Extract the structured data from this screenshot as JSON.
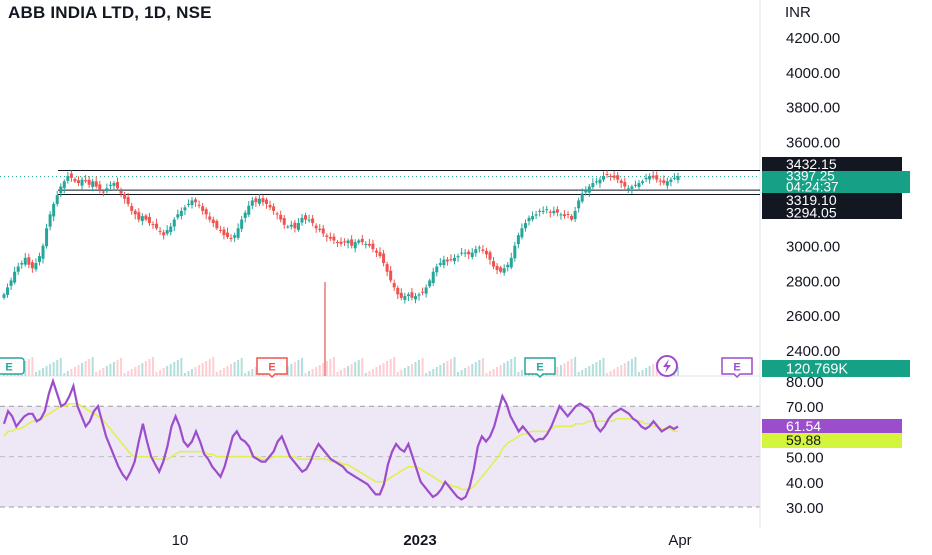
{
  "header": {
    "title": "ABB INDIA LTD, 1D, NSE"
  },
  "price_axis": {
    "currency": "INR",
    "ticks": [
      "4200.00",
      "4000.00",
      "3800.00",
      "3600.00",
      "3000.00",
      "2800.00",
      "2600.00",
      "2400.00"
    ],
    "tick_values": [
      4200,
      4000,
      3800,
      3600,
      3000,
      2800,
      2600,
      2400
    ]
  },
  "price_labels": {
    "resistance": "3432.15",
    "last": "3397.25",
    "countdown": "04:24:37",
    "support_upper": "3319.10",
    "support_lower": "3294.05",
    "volume": "120.769K"
  },
  "levels": {
    "resistance": 3432.15,
    "last": 3397.25,
    "support_upper": 3319.1,
    "support_lower": 3294.05
  },
  "rsi_axis": {
    "ticks": [
      "80.00",
      "70.00",
      "50.00",
      "40.00",
      "30.00"
    ],
    "tick_values": [
      80,
      70,
      50,
      40,
      30
    ],
    "rsi_label": "61.54",
    "ma_label": "59.88",
    "rsi_value": 61.54,
    "ma_value": 59.88,
    "band": [
      30,
      70
    ]
  },
  "time_axis": {
    "labels": [
      "10",
      "2023",
      "Apr"
    ]
  },
  "earnings_markers": {
    "label": "E"
  },
  "colors": {
    "up": "#26a69a",
    "down": "#ef5350",
    "rsi": "#9c4dcc",
    "rsi_ma": "#e1f04a",
    "band": "#ede7f6",
    "last_price": "#16a085",
    "rsi_badge": "#9c4dcc",
    "ma_badge": "#d4f53b"
  },
  "chart_data": {
    "type": "candlestick",
    "price_range": [
      2300,
      4300
    ],
    "rsi_range": [
      28,
      82
    ],
    "candles_close": [
      2720,
      2760,
      2800,
      2850,
      2880,
      2900,
      2930,
      2890,
      2870,
      2900,
      2940,
      3000,
      3100,
      3180,
      3240,
      3290,
      3340,
      3370,
      3400,
      3390,
      3370,
      3360,
      3380,
      3370,
      3350,
      3370,
      3340,
      3320,
      3310,
      3330,
      3350,
      3360,
      3330,
      3300,
      3270,
      3240,
      3200,
      3180,
      3150,
      3170,
      3150,
      3130,
      3120,
      3100,
      3080,
      3060,
      3090,
      3110,
      3150,
      3180,
      3200,
      3220,
      3240,
      3260,
      3250,
      3230,
      3200,
      3180,
      3150,
      3130,
      3100,
      3090,
      3060,
      3050,
      3040,
      3060,
      3100,
      3150,
      3190,
      3230,
      3260,
      3250,
      3270,
      3250,
      3240,
      3220,
      3200,
      3180,
      3150,
      3120,
      3110,
      3120,
      3100,
      3130,
      3160,
      3150,
      3150,
      3130,
      3100,
      3090,
      3070,
      3050,
      3040,
      3030,
      3020,
      3010,
      3020,
      3030,
      3000,
      3020,
      3030,
      3020,
      3010,
      3000,
      2980,
      2960,
      2940,
      2900,
      2850,
      2800,
      2760,
      2720,
      2700,
      2710,
      2720,
      2700,
      2710,
      2720,
      2730,
      2760,
      2800,
      2850,
      2880,
      2900,
      2920,
      2910,
      2920,
      2930,
      2940,
      2960,
      2960,
      2950,
      2960,
      2980,
      2990,
      2970,
      2950,
      2920,
      2880,
      2860,
      2850,
      2870,
      2890,
      2930,
      3000,
      3060,
      3100,
      3130,
      3160,
      3170,
      3180,
      3200,
      3200,
      3210,
      3190,
      3200,
      3190,
      3180,
      3170,
      3180,
      3150,
      3200,
      3260,
      3300,
      3320,
      3340,
      3360,
      3370,
      3380,
      3400,
      3410,
      3400,
      3390,
      3380,
      3360,
      3340,
      3330,
      3340,
      3350,
      3360,
      3370,
      3390,
      3400,
      3390,
      3380,
      3370,
      3360,
      3370,
      3380,
      3390,
      3400
    ],
    "rsi": [
      63,
      68,
      66,
      62,
      64,
      66,
      67,
      67,
      64,
      65,
      68,
      75,
      80,
      75,
      70,
      71,
      74,
      78,
      70,
      66,
      62,
      64,
      68,
      70,
      64,
      58,
      54,
      50,
      46,
      43,
      41,
      44,
      48,
      56,
      63,
      56,
      50,
      47,
      44,
      48,
      54,
      62,
      66,
      62,
      56,
      54,
      56,
      60,
      56,
      51,
      49,
      46,
      44,
      42,
      46,
      52,
      58,
      60,
      57,
      56,
      54,
      50,
      49,
      48,
      48,
      50,
      52,
      56,
      58,
      54,
      50,
      48,
      46,
      44,
      45,
      48,
      52,
      55,
      53,
      51,
      49,
      48,
      47,
      46,
      44,
      43,
      42,
      41,
      40,
      39,
      37,
      35,
      35,
      39,
      47,
      52,
      55,
      53,
      52,
      55,
      50,
      45,
      40,
      38,
      36,
      34,
      35,
      37,
      40,
      38,
      36,
      34,
      33,
      34,
      38,
      45,
      54,
      58,
      56,
      58,
      62,
      68,
      74,
      71,
      66,
      63,
      60,
      62,
      60,
      58,
      56,
      57,
      57,
      59,
      62,
      66,
      70,
      68,
      66,
      68,
      70,
      71,
      70,
      69,
      67,
      62,
      60,
      62,
      65,
      67,
      68,
      69,
      68,
      67,
      65,
      64,
      62,
      61,
      62,
      64,
      62,
      60,
      61,
      62,
      61,
      62
    ],
    "rsi_ma": [
      58,
      60,
      60,
      61,
      61,
      62,
      63,
      64,
      64,
      65,
      66,
      67,
      68,
      69,
      70,
      70,
      71,
      71,
      71,
      70,
      69,
      68,
      67,
      66,
      65,
      63,
      61,
      59,
      57,
      55,
      53,
      51,
      50,
      50,
      50,
      50,
      50,
      49,
      49,
      49,
      49,
      50,
      51,
      52,
      52,
      52,
      52,
      52,
      52,
      52,
      51,
      51,
      50,
      50,
      50,
      50,
      50,
      50,
      50,
      50,
      50,
      50,
      50,
      49,
      49,
      49,
      50,
      50,
      50,
      50,
      50,
      50,
      49,
      49,
      49,
      49,
      49,
      49,
      49,
      49,
      48,
      48,
      48,
      47,
      47,
      46,
      45,
      44,
      43,
      42,
      41,
      40,
      40,
      40,
      41,
      42,
      43,
      44,
      45,
      46,
      46,
      46,
      45,
      44,
      43,
      42,
      41,
      40,
      39,
      39,
      38,
      38,
      37,
      37,
      37,
      38,
      40,
      42,
      44,
      46,
      48,
      50,
      53,
      55,
      56,
      57,
      58,
      59,
      59,
      60,
      60,
      60,
      60,
      60,
      61,
      62,
      62,
      62,
      62,
      62,
      63,
      63,
      63,
      64,
      64,
      64,
      64,
      64,
      64,
      64,
      65,
      65,
      65,
      65,
      65,
      64,
      64,
      63,
      63,
      62,
      62,
      61,
      61,
      61,
      60,
      60
    ]
  }
}
